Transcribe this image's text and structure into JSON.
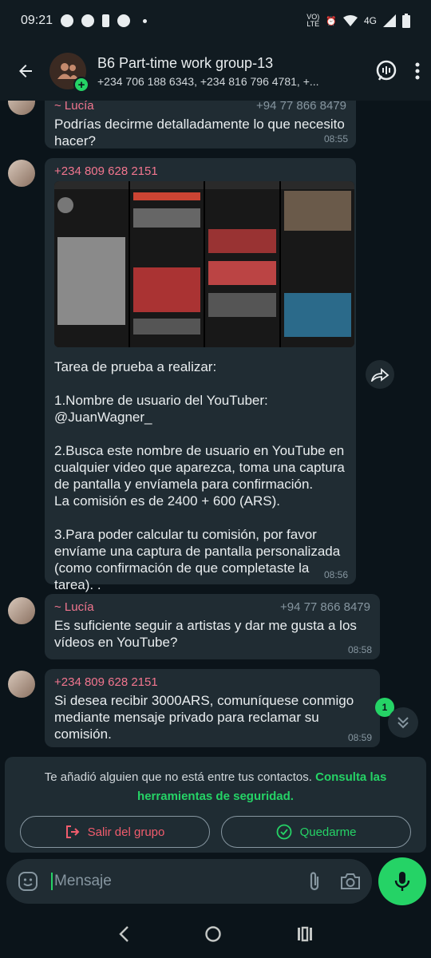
{
  "status": {
    "time": "09:21",
    "network": "4G"
  },
  "header": {
    "title": "B6 Part-time work group-13",
    "subtitle": "+234 706 188 6343, +234 816 796 4781, +..."
  },
  "messages": [
    {
      "sender": "~ Lucía",
      "phone": "+94 77 866 8479",
      "text": "Podrías decirme detalladamente lo que necesito hacer?",
      "time": "08:55"
    },
    {
      "sender": "+234 809 628 2151",
      "text": "Tarea de prueba a realizar:\n\n1.Nombre de usuario del YouTuber: @JuanWagner_\n\n2.Busca este nombre de usuario en YouTube en cualquier video que aparezca, toma una captura de pantalla y envíamela para confirmación.\nLa comisión es de 2400 + 600 (ARS).\n\n3.Para poder calcular tu comisión, por favor envíame una captura de pantalla personalizada (como confirmación de que completaste la tarea). .",
      "time": "08:56"
    },
    {
      "sender": "~ Lucía",
      "phone": "+94 77 866 8479",
      "text": "Es suficiente seguir a artistas y dar me gusta a los vídeos en YouTube?",
      "time": "08:58"
    },
    {
      "sender": "+234 809 628 2151",
      "text": "Si desea recibir 3000ARS, comuníquese conmigo mediante mensaje privado para reclamar su comisión.",
      "time": "08:59"
    }
  ],
  "unread_count": "1",
  "banner": {
    "text": "Te añadió alguien que no está entre tus contactos.",
    "link": "Consulta las herramientas de seguridad.",
    "leave_label": "Salir del grupo",
    "stay_label": "Quedarme"
  },
  "composer": {
    "placeholder": "Mensaje"
  },
  "colors": {
    "accent": "#25d366",
    "sender_pink": "#f2768f",
    "bubble": "#202c33",
    "danger": "#f15c6d"
  }
}
